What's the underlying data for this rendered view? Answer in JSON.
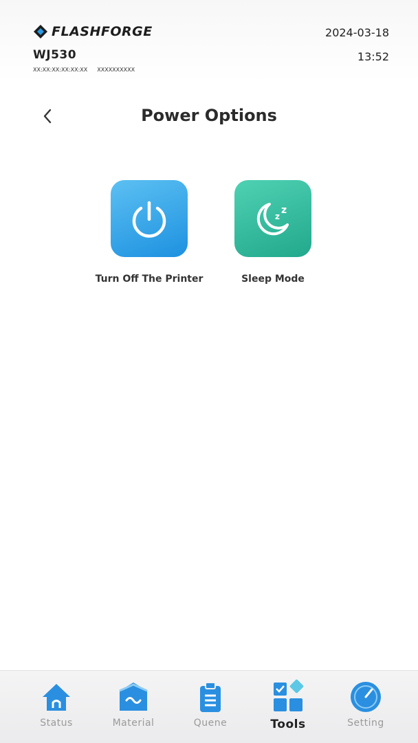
{
  "header": {
    "brand": "FLASHFORGE",
    "device_name": "WJ530",
    "device_mac": "XX:XX:XX:XX:XX:XX",
    "device_serial": "XXXXXXXXXX",
    "date": "2024-03-18",
    "time": "13:52"
  },
  "page": {
    "title": "Power Options",
    "back_icon": "chevron-left-icon"
  },
  "options": [
    {
      "label": "Turn Off The Printer",
      "icon": "power-icon",
      "color": "#2a9ae4"
    },
    {
      "label": "Sleep Mode",
      "icon": "moon-sleep-icon",
      "color": "#2fb897"
    }
  ],
  "nav": {
    "active": "Tools",
    "accent": "#2a8fe0",
    "items": [
      {
        "label": "Status",
        "icon": "home-icon"
      },
      {
        "label": "Material",
        "icon": "material-icon"
      },
      {
        "label": "Quene",
        "icon": "clipboard-icon"
      },
      {
        "label": "Tools",
        "icon": "tools-icon"
      },
      {
        "label": "Setting",
        "icon": "gauge-icon"
      }
    ]
  }
}
